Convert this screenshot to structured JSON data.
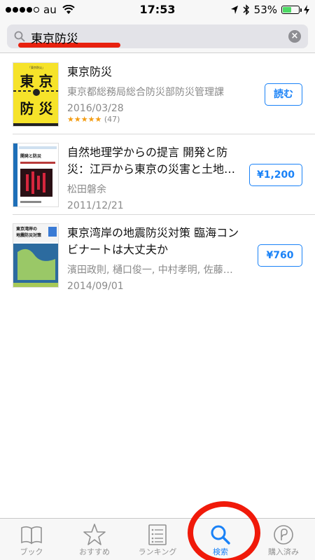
{
  "status_bar": {
    "carrier": "au",
    "time": "17:53",
    "battery": "53%",
    "battery_level": 0.53
  },
  "search": {
    "query": "東京防災",
    "clear_icon": "clear-icon"
  },
  "results": [
    {
      "title": "東京防災",
      "author": "東京都総務局総合防災部防災管理課",
      "date": "2016/03/28",
      "stars": "★★★★★",
      "rating_count": "(47)",
      "action": "読む",
      "cover": "tokyo-bousai-cover"
    },
    {
      "title": "自然地理学からの提言 開発と防災：江戸から東京の災害と土地…",
      "author": "松田磐余",
      "date": "2011/12/21",
      "action": "¥1,200",
      "cover": "shizen-chiri-cover"
    },
    {
      "title": "東京湾岸の地震防災対策 臨海コンビナートは大丈夫か",
      "author": "濱田政則, 樋口俊一, 中村孝明, 佐藤孝治…",
      "date": "2014/09/01",
      "action": "¥760",
      "cover": "tokyo-wangan-cover"
    }
  ],
  "tabs": [
    {
      "label": "ブック",
      "icon": "book-icon"
    },
    {
      "label": "おすすめ",
      "icon": "star-icon"
    },
    {
      "label": "ランキング",
      "icon": "list-icon"
    },
    {
      "label": "検索",
      "icon": "search-icon",
      "active": true
    },
    {
      "label": "購入済み",
      "icon": "purchased-icon"
    }
  ],
  "colors": {
    "accent": "#1a82f7",
    "annotation": "#f01a0a",
    "star": "#f39c12"
  }
}
